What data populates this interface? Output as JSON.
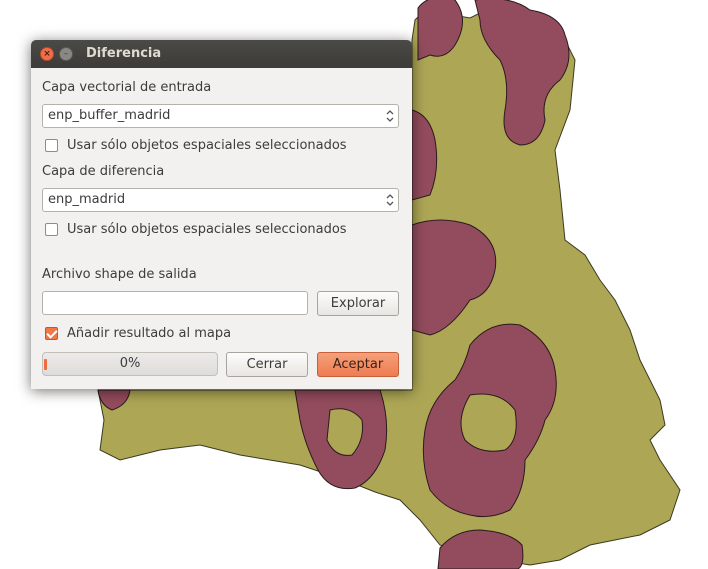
{
  "window": {
    "title": "Diferencia"
  },
  "form": {
    "input_layer_label": "Capa vectorial de entrada",
    "input_layer_value": "enp_buffer_madrid",
    "input_selected_only_label": "Usar sólo objetos espaciales seleccionados",
    "input_selected_only_checked": false,
    "diff_layer_label": "Capa de diferencia",
    "diff_layer_value": "enp_madrid",
    "diff_selected_only_label": "Usar sólo objetos espaciales seleccionados",
    "diff_selected_only_checked": false,
    "output_label": "Archivo shape de salida",
    "output_value": "",
    "browse_label": "Explorar",
    "add_to_map_label": "Añadir resultado al mapa",
    "add_to_map_checked": true
  },
  "progress": {
    "value": 0,
    "text": "0%"
  },
  "buttons": {
    "close": "Cerrar",
    "accept": "Aceptar"
  },
  "colors": {
    "region_fill": "#ada655",
    "buffer_fill": "#934c5d",
    "accent": "#ee7c50"
  }
}
